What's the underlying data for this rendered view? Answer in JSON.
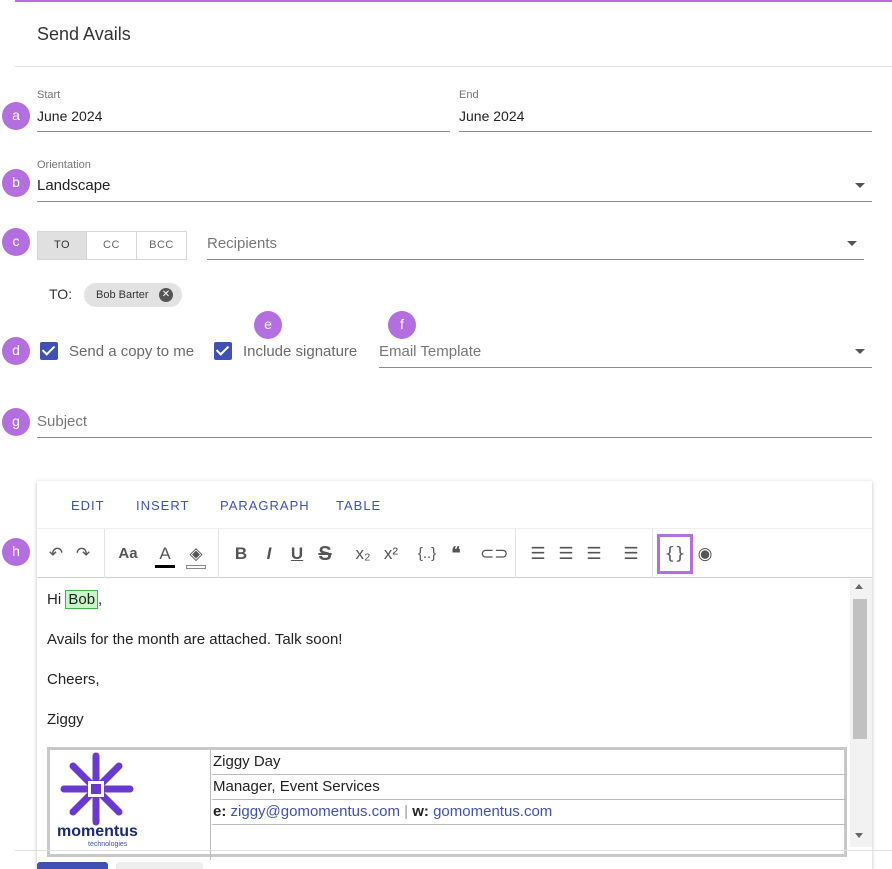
{
  "dialog": {
    "title": "Send Avails"
  },
  "markers": {
    "a": "a",
    "b": "b",
    "c": "c",
    "d": "d",
    "e": "e",
    "f": "f",
    "g": "g",
    "h": "h"
  },
  "start": {
    "label": "Start",
    "value": "June 2024"
  },
  "end": {
    "label": "End",
    "value": "June 2024"
  },
  "orientation": {
    "label": "Orientation",
    "value": "Landscape"
  },
  "recipient_types": [
    "TO",
    "CC",
    "BCC"
  ],
  "recipients": {
    "placeholder": "Recipients",
    "to_label": "TO:",
    "chips": [
      "Bob Barter"
    ]
  },
  "options": {
    "send_copy": {
      "label": "Send a copy to me",
      "checked": true
    },
    "include_signature": {
      "label": "Include signature",
      "checked": true
    },
    "email_template": {
      "placeholder": "Email Template"
    }
  },
  "subject": {
    "placeholder": "Subject"
  },
  "editor": {
    "menu": [
      "EDIT",
      "INSERT",
      "PARAGRAPH",
      "TABLE"
    ],
    "toolbar_icons": [
      "undo-icon",
      "redo-icon",
      "font-size-icon",
      "text-color-icon",
      "highlight-color-icon",
      "bold-icon",
      "italic-icon",
      "underline-icon",
      "strikethrough-icon",
      "subscript-icon",
      "superscript-icon",
      "code-block-icon",
      "blockquote-icon",
      "link-icon",
      "align-left-icon",
      "align-center-icon",
      "align-right-icon",
      "justify-icon",
      "merge-field-icon",
      "preview-icon"
    ],
    "body": {
      "greeting_prefix": "Hi ",
      "greeting_name": "Bob",
      "greeting_suffix": ",",
      "line2": "Avails for the month are attached. Talk soon!",
      "line3": "Cheers,",
      "line4": "Ziggy"
    },
    "signature": {
      "logo_text": "momentus",
      "logo_subtext": "technologies",
      "name": "Ziggy Day",
      "title": "Manager, Event Services",
      "email_label": "e:",
      "email": "ziggy@gomomentus.com",
      "divider": "|",
      "web_label": "w:",
      "web": "gomomentus.com"
    }
  },
  "colors": {
    "accent": "#b36ee0",
    "primary": "#3f51b5"
  }
}
